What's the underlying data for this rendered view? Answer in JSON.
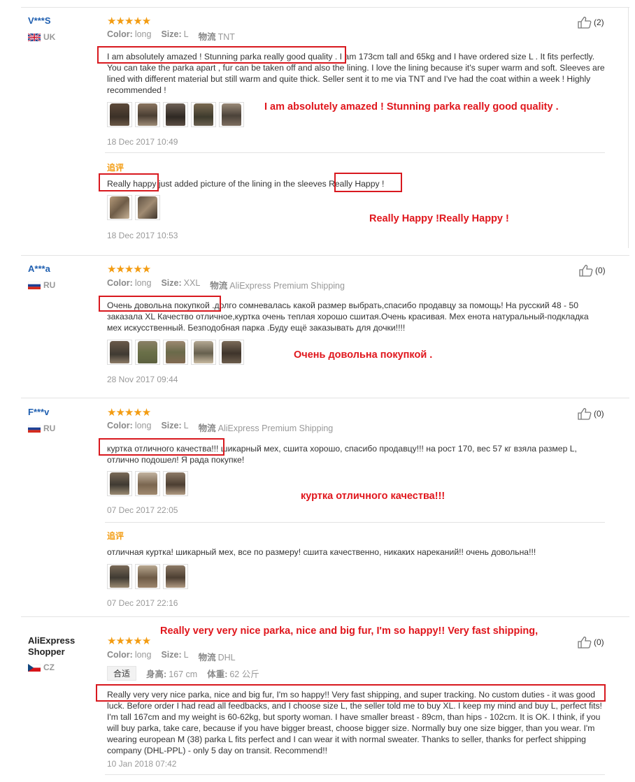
{
  "reviews": [
    {
      "user": "V***S",
      "country": "UK",
      "stars": "★★★★★",
      "meta": {
        "color_label": "Color:",
        "color": "long",
        "size_label": "Size:",
        "size": "L",
        "ship_label": "物流",
        "ship": "TNT"
      },
      "likes": "(2)",
      "text_hl": "I am absolutely amazed ! Stunning parka really good quality .",
      "text_rest": " I am 173cm tall and 65kg and I have ordered size L . It fits perfectly. You can take the parka apart , fur can be taken off and also the lining. I love the lining because it's super warm and soft. Sleeves are lined with different material but still warm and quite thick. Seller sent it to me via TNT and I've had the coat within a week ! Highly recommended !",
      "annotation": "I am absolutely amazed ! Stunning parka really good quality .",
      "date": "18 Dec 2017 10:49",
      "followup": {
        "label": "追评",
        "text_a": "Really happy",
        "text_b": " just added picture of the lining in the sleeves ",
        "text_c": "Really Happy !",
        "annotation": "Really Happy !Really Happy !",
        "date": "18 Dec 2017 10:53"
      }
    },
    {
      "user": "A***a",
      "country": "RU",
      "stars": "★★★★★",
      "meta": {
        "color_label": "Color:",
        "color": "long",
        "size_label": "Size:",
        "size": "XXL",
        "ship_label": "物流",
        "ship": "AliExpress Premium Shipping"
      },
      "likes": "(0)",
      "text_hl": "Очень довольна покупкой",
      "text_rest": " .долго сомневалась какой размер выбрать,спасибо продавцу за помощь! На русский 48 - 50 заказала XL Качество отличное,куртка очень теплая хорошо сшитая.Очень красивая. Мех енота натуральный-подкладка мех искусственный. Безподобная парка .Буду ещё заказывать для дочки!!!!",
      "annotation": "Очень довольна покупкой .",
      "date": "28 Nov 2017 09:44"
    },
    {
      "user": "F***v",
      "country": "RU",
      "stars": "★★★★★",
      "meta": {
        "color_label": "Color:",
        "color": "long",
        "size_label": "Size:",
        "size": "L",
        "ship_label": "物流",
        "ship": "AliExpress Premium Shipping"
      },
      "likes": "(0)",
      "text_hl": "куртка отличного качества!!!",
      "text_rest": " шикарный мех, сшита хорошо, спасибо продавцу!!! на рост 170, вес 57 кг взяла размер L, отлично подошел! Я рада покупке!",
      "annotation": "куртка отличного качества!!!",
      "date": "07 Dec 2017 22:05",
      "followup": {
        "label": "追评",
        "text": "отличная куртка! шикарный мех, все по размеру! сшита качественно, никаких нареканий!! очень довольна!!!",
        "date": "07 Dec 2017 22:16"
      }
    },
    {
      "user": "AliExpress Shopper",
      "country": "CZ",
      "stars": "★★★★★",
      "meta": {
        "color_label": "Color:",
        "color": "long",
        "size_label": "Size:",
        "size": "L",
        "ship_label": "物流",
        "ship": "DHL"
      },
      "fit_tag": "合适",
      "height_label": "身高:",
      "height": "167 cm",
      "weight_label": "体重:",
      "weight": "62 公斤",
      "likes": "(0)",
      "text_hl": "Really very very nice parka, nice and big fur, I'm so happy!! Very fast shipping, and super tracking. No custom duties - it was good",
      "text_rest": " luck. Before order I had read all feedbacks, and I choose size L, the seller told me to buy XL. I keep my mind and buy L, perfect fits! I'm tall 167cm and my weight is 60-62kg, but sporty woman. I have smaller breast - 89cm, than hips - 102cm. It is OK. I think, if you will buy parka, take care, because if you have bigger breast, choose bigger size. Normally buy one size bigger, than you wear. I'm wearing european M (38) parka L fits perfect and I can wear it with normal sweater. Thanks to seller, thanks for perfect shipping company (DHL-PPL) - only 5 day on transit. Recommend!!",
      "annotation": "Really very very nice parka, nice and big fur, I'm so happy!! Very fast shipping,",
      "date": "10 Jan 2018 07:42"
    }
  ]
}
